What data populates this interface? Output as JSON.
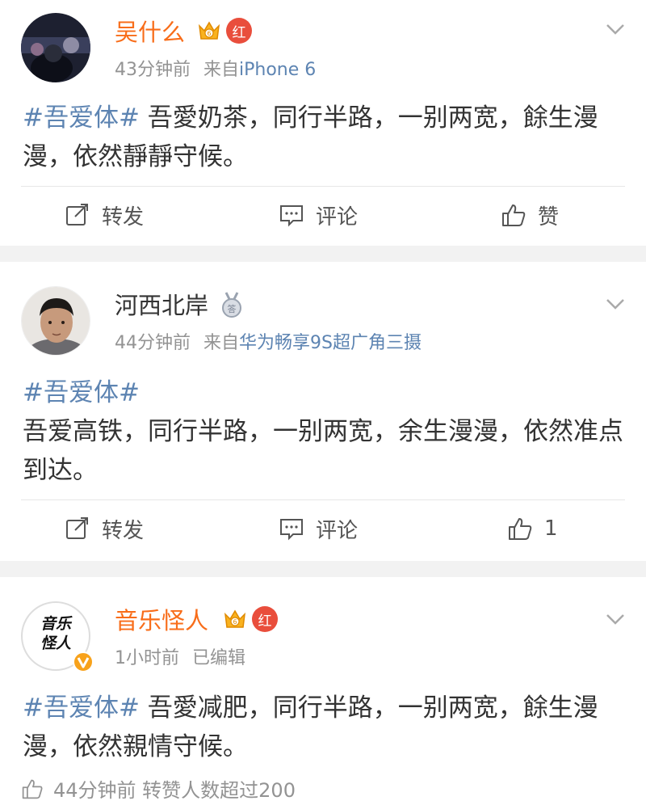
{
  "posts": [
    {
      "username": "吴什么",
      "time": "43分钟前",
      "source_prefix": "来自",
      "source": "iPhone 6",
      "hashtag": "#吾爱体#",
      "text": " 吾愛奶茶，同行半路，一别两宽，餘生漫漫，依然靜靜守候。",
      "actions": {
        "repost": "转发",
        "comment": "评论",
        "like": "赞"
      }
    },
    {
      "username": "河西北岸",
      "time": "44分钟前",
      "source_prefix": "来自",
      "source": "华为畅享9S超广角三摄",
      "hashtag": "#吾爱体#",
      "text": "吾爱高铁，同行半路，一别两宽，余生漫漫，依然准点到达。",
      "actions": {
        "repost": "转发",
        "comment": "评论",
        "like": "1"
      }
    },
    {
      "username": "音乐怪人",
      "avatar_text_1": "音乐",
      "avatar_text_2": "怪人",
      "time": "1小时前",
      "edited": "已编辑",
      "hashtag": "#吾爱体#",
      "text": " 吾愛减肥，同行半路，一别两宽，餘生漫漫，依然親情守候。",
      "footer": "44分钟前 转赞人数超过200"
    }
  ],
  "badge_hong": "红",
  "colors": {
    "vip_name": "#f86d1a",
    "link": "#5d84b2",
    "meta": "#939393",
    "separator": "#f2f2f2"
  },
  "icons": [
    "chevron-down-icon",
    "repost-icon",
    "comment-icon",
    "like-icon",
    "vip-crown-icon",
    "hong-badge-icon",
    "medal-icon",
    "verified-v-icon"
  ]
}
